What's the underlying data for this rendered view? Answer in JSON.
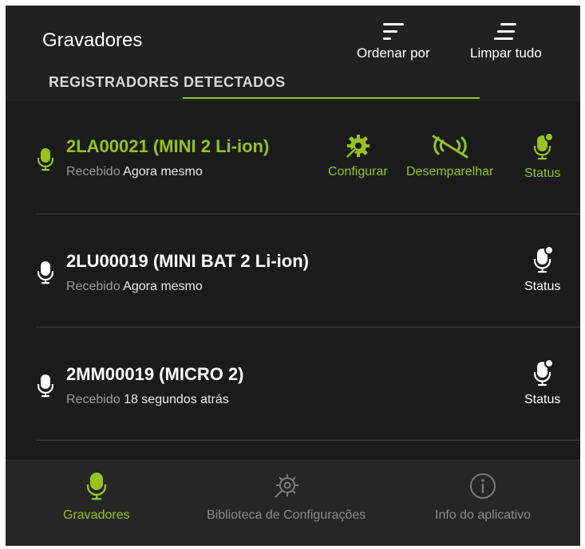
{
  "header": {
    "title": "Gravadores",
    "sort_label": "Ordenar por",
    "clear_label": "Limpar tudo",
    "section_label": "REGISTRADORES DETECTADOS",
    "sort_icon": "sort-icon",
    "clear_icon": "clear-all-icon"
  },
  "colors": {
    "accent": "#98c21a",
    "background": "#212121",
    "list_background": "#1b1b1b",
    "muted_text": "#9a9a9a"
  },
  "recorders": [
    {
      "name": "2LA00021 (MINI 2 Li-ion)",
      "received_label": "Recebido",
      "received_value": "Agora mesmo",
      "paired": true,
      "actions": {
        "configure": "Configurar",
        "unpair": "Desemparelhar",
        "status": "Status"
      }
    },
    {
      "name": "2LU00019 (MINI BAT 2 Li-ion)",
      "received_label": "Recebido",
      "received_value": "Agora mesmo",
      "paired": false,
      "actions": {
        "status": "Status"
      }
    },
    {
      "name": "2MM00019 (MICRO 2)",
      "received_label": "Recebido",
      "received_value": "18 segundos atrás",
      "paired": false,
      "actions": {
        "status": "Status"
      }
    }
  ],
  "bottom_nav": [
    {
      "label": "Gravadores",
      "icon": "microphone-icon",
      "active": true
    },
    {
      "label": "Biblioteca de Configurações",
      "icon": "gear-wrench-icon",
      "active": false
    },
    {
      "label": "Info do aplicativo",
      "icon": "info-icon",
      "active": false
    }
  ]
}
